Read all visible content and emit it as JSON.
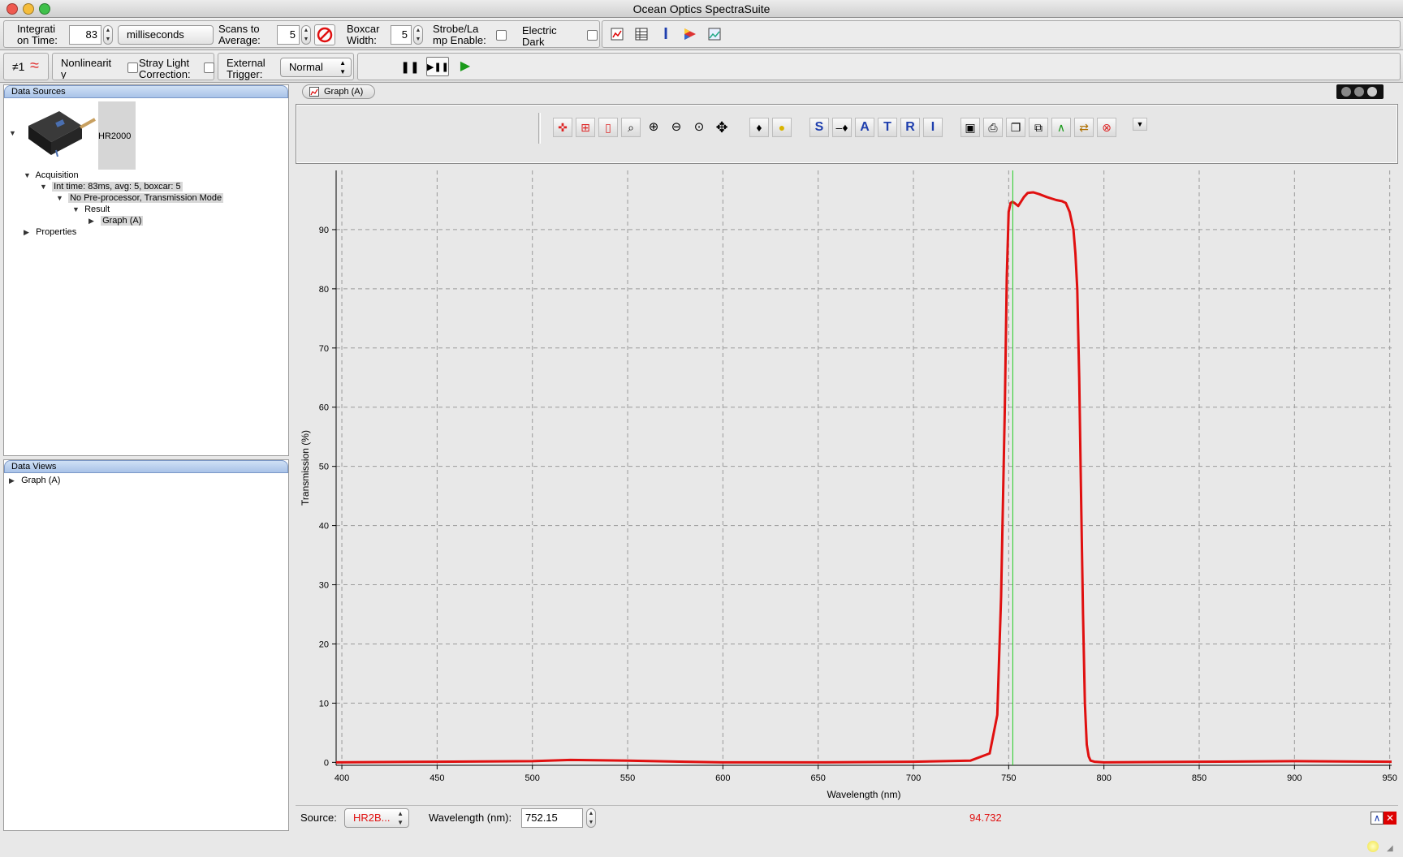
{
  "window": {
    "title": "Ocean Optics SpectraSuite"
  },
  "toolbar1": {
    "integration_label": "Integrati\non Time:",
    "integration_value": "83",
    "units": "milliseconds",
    "scans_label": "Scans to\nAverage:",
    "scans_value": "5",
    "boxcar_label": "Boxcar\nWidth:",
    "boxcar_value": "5",
    "strobe_label": "Strobe/La\nmp Enable:",
    "electric_dark_label": "Electric\nDark"
  },
  "toolbar2": {
    "channel_label": "≠1",
    "nonlinearity_label": "Nonlinearit\ny",
    "stray_light_label": "Stray Light\nCorrection:",
    "external_trigger_label": "External\nTrigger:",
    "trigger_mode": "Normal"
  },
  "data_sources": {
    "title": "Data Sources",
    "device": "HR2000",
    "acquisition": "Acquisition",
    "int_time": "Int time: 83ms, avg: 5, boxcar: 5",
    "preprocessor": "No Pre-processor, Transmission Mode",
    "result": "Result",
    "graph": "Graph (A)",
    "properties": "Properties"
  },
  "data_views": {
    "title": "Data Views",
    "graph": "Graph (A)"
  },
  "graph_tab": {
    "label": "Graph (A)"
  },
  "graph_tools": {
    "letters": [
      "S",
      "A",
      "T",
      "R",
      "I"
    ]
  },
  "status": {
    "source_label": "Source:",
    "source_value": "HR2B...",
    "wavelength_label": "Wavelength (nm):",
    "wavelength_value": "752.15",
    "readout": "94.732"
  },
  "colors": {
    "trace": "#e01010",
    "cursor": "#22cc22",
    "readout": "#e01010"
  },
  "chart_data": {
    "type": "line",
    "xlabel": "Wavelength (nm)",
    "ylabel": "Transmission (%)",
    "xlim": [
      397,
      951
    ],
    "ylim": [
      -0.5,
      100
    ],
    "xticks": [
      400,
      450,
      500,
      550,
      600,
      650,
      700,
      750,
      800,
      850,
      900,
      950
    ],
    "yticks": [
      0,
      10,
      20,
      30,
      40,
      50,
      60,
      70,
      80,
      90
    ],
    "grid": true,
    "cursor_x": 752.15,
    "series": [
      {
        "x": [
          397,
          450,
          500,
          520,
          550,
          580,
          600,
          650,
          700,
          730,
          740,
          744,
          746,
          748,
          749,
          750,
          751,
          752,
          753,
          755,
          758,
          760,
          763,
          766,
          770,
          775,
          778,
          780,
          782,
          784,
          785,
          786,
          787,
          788,
          789,
          790,
          791,
          792,
          793,
          795,
          800,
          850,
          900,
          951
        ],
        "y": [
          0,
          0.1,
          0.2,
          0.4,
          0.3,
          0.1,
          0,
          0,
          0.1,
          0.3,
          1.5,
          8,
          28,
          60,
          82,
          93,
          94.5,
          94.7,
          94.5,
          94,
          95.5,
          96.2,
          96.3,
          96,
          95.5,
          95,
          94.8,
          94.5,
          93,
          90,
          86,
          80,
          65,
          45,
          25,
          10,
          3,
          1,
          0.3,
          0.1,
          0,
          0.1,
          0.2,
          0.1
        ]
      }
    ]
  }
}
